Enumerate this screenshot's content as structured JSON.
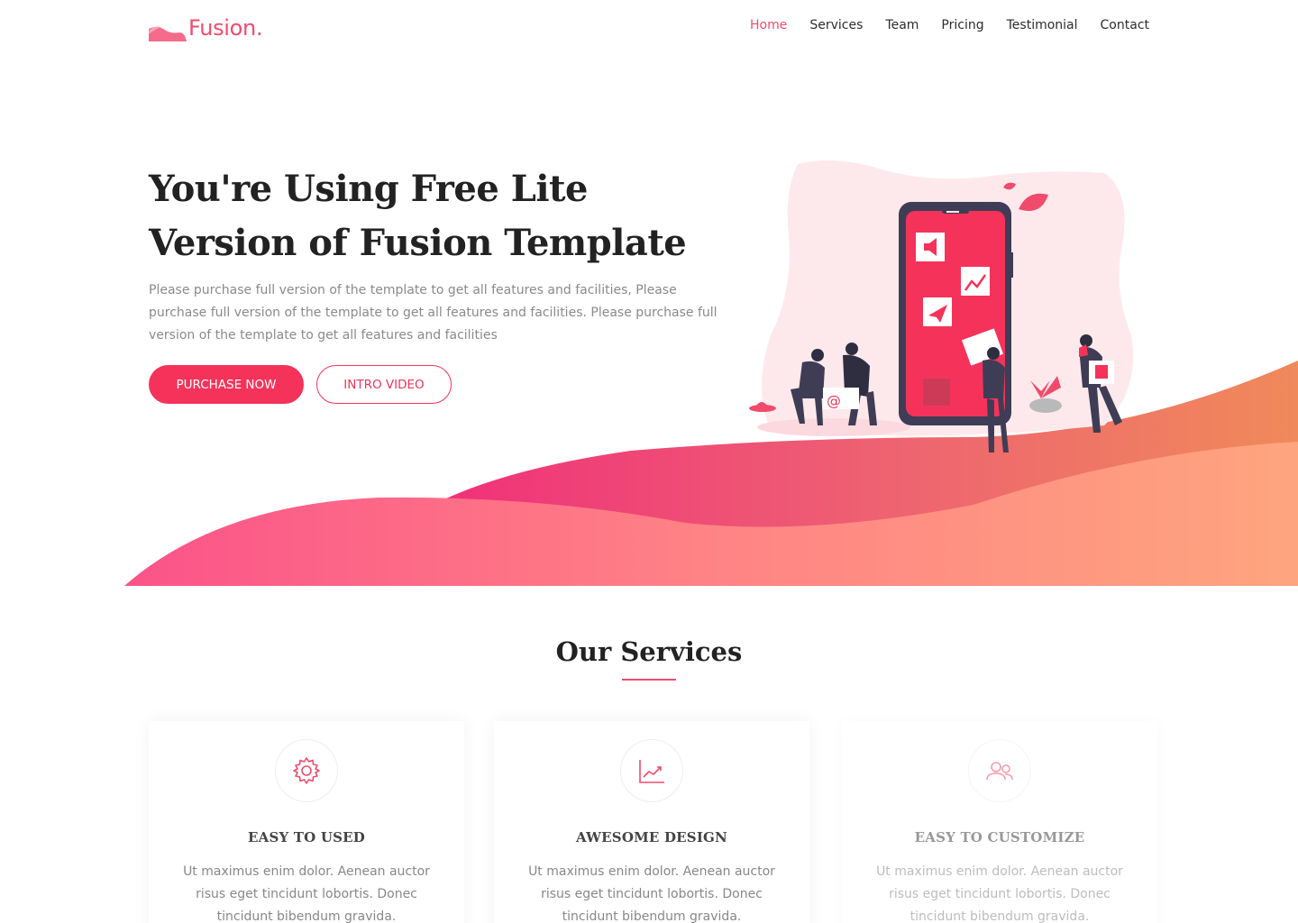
{
  "header": {
    "logo_text": "Fusion.",
    "nav": [
      {
        "label": "Home",
        "active": true
      },
      {
        "label": "Services",
        "active": false
      },
      {
        "label": "Team",
        "active": false
      },
      {
        "label": "Pricing",
        "active": false
      },
      {
        "label": "Testimonial",
        "active": false
      },
      {
        "label": "Contact",
        "active": false
      }
    ]
  },
  "hero": {
    "title_line1": "You're Using Free Lite",
    "title_line2": "Version of Fusion Template",
    "description": "Please purchase full version of the template to get all features and facilities, Please purchase full version of the template to get all features and facilities. Please purchase full version of the template to get all features and facilities",
    "primary_button": "Purchase Now",
    "secondary_button": "Intro Video"
  },
  "services": {
    "title": "Our Services",
    "cards": [
      {
        "icon": "gear-icon",
        "title": "Easy to Used",
        "text": "Ut maximus enim dolor. Aenean auctor risus eget tincidunt lobortis. Donec tincidunt bibendum gravida."
      },
      {
        "icon": "chart-icon",
        "title": "Awesome Design",
        "text": "Ut maximus enim dolor. Aenean auctor risus eget tincidunt lobortis. Donec tincidunt bibendum gravida."
      },
      {
        "icon": "users-icon",
        "title": "Easy to Customize",
        "text": "Ut maximus enim dolor. Aenean auctor risus eget tincidunt lobortis. Donec tincidunt bibendum gravida."
      }
    ]
  },
  "colors": {
    "accent": "#f5335a",
    "gradient_start": "#f0427a",
    "gradient_end": "#fea57e"
  }
}
